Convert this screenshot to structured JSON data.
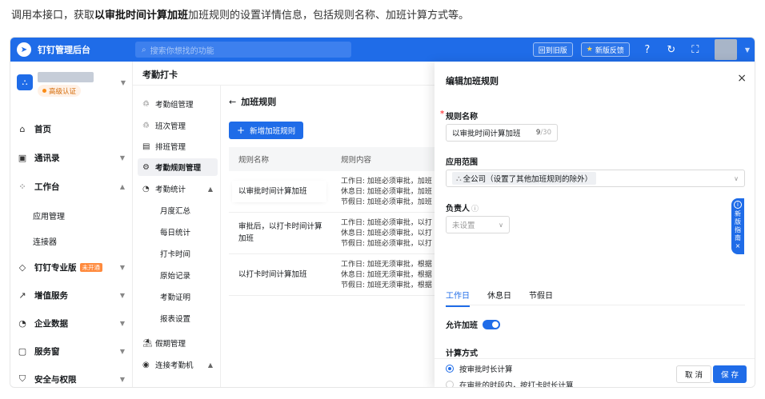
{
  "intro": {
    "before": "调用本接口，获取",
    "bold": "以审批时间计算加班",
    "after": "加班规则的设置详情信息，包括规则名称、加班计算方式等。"
  },
  "topbar": {
    "brand": "钉钉管理后台",
    "search_placeholder": "搜索你想找的功能",
    "back_old": "回到旧版",
    "feedback": "新版反馈"
  },
  "sidebar": {
    "org_badge": "高级认证",
    "items": [
      {
        "label": "首页",
        "icon": "home-icon"
      },
      {
        "label": "通讯录",
        "icon": "contacts-icon"
      },
      {
        "label": "工作台",
        "icon": "workbench-icon"
      },
      {
        "label": "应用管理"
      },
      {
        "label": "连接器"
      },
      {
        "label": "钉钉专业版",
        "tag": "未开通",
        "icon": "diamond-icon"
      },
      {
        "label": "增值服务",
        "icon": "trend-icon"
      },
      {
        "label": "企业数据",
        "icon": "data-icon"
      },
      {
        "label": "服务窗",
        "icon": "window-icon"
      },
      {
        "label": "安全与权限",
        "icon": "shield-icon"
      }
    ]
  },
  "section_title": "考勤打卡",
  "subnav": [
    {
      "label": "考勤组管理"
    },
    {
      "label": "班次管理"
    },
    {
      "label": "排班管理"
    },
    {
      "label": "考勤规则管理"
    },
    {
      "label": "考勤统计"
    },
    {
      "label": "月度汇总"
    },
    {
      "label": "每日统计"
    },
    {
      "label": "打卡时间"
    },
    {
      "label": "原始记录"
    },
    {
      "label": "考勤证明"
    },
    {
      "label": "报表设置"
    },
    {
      "label": "假期管理"
    },
    {
      "label": "连接考勤机"
    }
  ],
  "page": {
    "back_title": "加班规则",
    "add_button": "新增加班规则",
    "columns": [
      "规则名称",
      "规则内容"
    ],
    "rows": [
      {
        "name": "以审批时间计算加班",
        "lines": [
          "工作日: 加班必须审批，加班",
          "休息日: 加班必须审批，加班",
          "节假日: 加班必须审批，加班"
        ]
      },
      {
        "name": "审批后，以打卡时间计算加班",
        "lines": [
          "工作日: 加班必须审批，以打",
          "休息日: 加班必须审批，以打",
          "节假日: 加班必须审批，以打"
        ]
      },
      {
        "name": "以打卡时间计算加班",
        "lines": [
          "工作日: 加班无须审批，根据",
          "休息日: 加班无须审批，根据",
          "节假日: 加班无须审批，根据"
        ]
      }
    ]
  },
  "drawer": {
    "title": "编辑加班规则",
    "name_label": "规则名称",
    "name_value": "以审批时间计算加班",
    "name_count": "9",
    "name_max": "/30",
    "scope_label": "应用范围",
    "scope_value": "全公司（设置了其他加班规则的除外）",
    "owner_label": "负责人",
    "owner_placeholder": "未设置",
    "tabs": [
      "工作日",
      "休息日",
      "节假日"
    ],
    "allow_label": "允许加班",
    "calc_label": "计算方式",
    "option1": "按审批时长计算",
    "option2": "在审批的时段内，按打卡时长计算",
    "cancel": "取 消",
    "save": "保 存"
  },
  "guide": {
    "label": "新版指南"
  },
  "colors": {
    "primary": "#1f6ce8",
    "tag_orange": "#ff8a3d"
  }
}
